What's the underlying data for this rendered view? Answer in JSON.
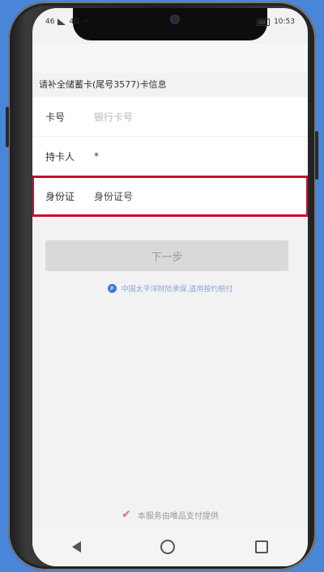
{
  "status_bar": {
    "carrier": "46",
    "network": "4G",
    "time": "10:53"
  },
  "section_title": "请补全储蓄卡(尾号3577)卡信息",
  "form": {
    "card_number": {
      "label": "卡号",
      "placeholder": "银行卡号"
    },
    "cardholder": {
      "label": "持卡人",
      "value": "*"
    },
    "id_number": {
      "label": "身份证",
      "placeholder": "身份证号"
    }
  },
  "next_button": "下一步",
  "insurance_note": "中国太平洋财险承保,盗用按约赔付",
  "footer_note": "本服务由唯品支付提供",
  "icons": {
    "insurance": "shield-p-icon",
    "provider": "vip-logo-icon"
  },
  "colors": {
    "highlight": "#c8102e",
    "accent": "#3b78d8"
  }
}
